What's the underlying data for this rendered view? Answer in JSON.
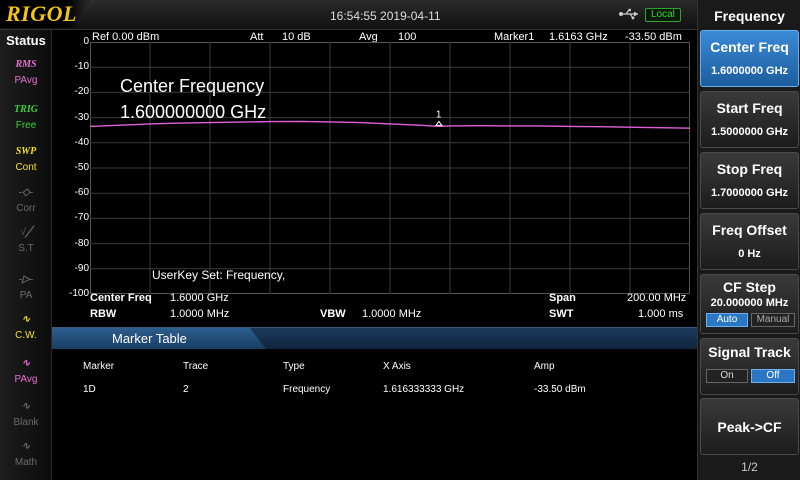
{
  "brand": "RIGOL",
  "clock": "16:54:55 2019-04-11",
  "remote": "Local",
  "status": {
    "title": "Status",
    "items": [
      {
        "icon": "RMS",
        "label": "PAvg",
        "color": "#e86fd0",
        "active": true
      },
      {
        "icon": "TRIG",
        "label": "Free",
        "color": "#3ad23a",
        "active": true
      },
      {
        "icon": "SWP",
        "label": "Cont",
        "color": "#f0e020",
        "active": true
      },
      {
        "icon": "-◇-",
        "label": "Corr",
        "color": "#6a6a6a",
        "active": false
      },
      {
        "icon": "√╱",
        "label": "S.T",
        "color": "#6a6a6a",
        "active": false
      },
      {
        "icon": "-▷-",
        "label": "PA",
        "color": "#6a6a6a",
        "active": false
      },
      {
        "icon": "∿",
        "label": "C.W.",
        "color": "#f0e020",
        "active": true
      },
      {
        "icon": "∿",
        "label": "PAvg",
        "color": "#e86fd0",
        "active": true
      },
      {
        "icon": "∿",
        "label": "Blank",
        "color": "#6a6a6a",
        "active": false
      },
      {
        "icon": "∿",
        "label": "Math",
        "color": "#6a6a6a",
        "active": false
      }
    ]
  },
  "plot_header": {
    "ref": "Ref  0.00 dBm",
    "att_label": "Att",
    "att_value": "10 dB",
    "avg_label": "Avg",
    "avg_value": "100",
    "marker_label": "Marker1",
    "marker_freq": "1.6163 GHz",
    "marker_amp": "-33.50 dBm"
  },
  "overlay": {
    "line1": "Center Frequency",
    "line2": "1.600000000 GHz",
    "userkey": "UserKey Set:    Frequency,",
    "marker_tag": "1"
  },
  "chart_data": {
    "type": "line",
    "ylim": [
      -100,
      0
    ],
    "yticks": [
      "0",
      "-10",
      "-20",
      "-30",
      "-40",
      "-50",
      "-60",
      "-70",
      "-80",
      "-90",
      "-100"
    ],
    "xlim_ghz": [
      1.5,
      1.7
    ],
    "grid": true,
    "series": [
      {
        "color": "#e060d8",
        "x": [
          1.5,
          1.51,
          1.52,
          1.53,
          1.54,
          1.55,
          1.56,
          1.57,
          1.58,
          1.59,
          1.6,
          1.61,
          1.6163,
          1.62,
          1.63,
          1.64,
          1.65,
          1.66,
          1.67,
          1.68,
          1.69,
          1.7
        ],
        "y": [
          -33.5,
          -33.0,
          -32.5,
          -32.2,
          -32.0,
          -31.8,
          -31.6,
          -31.5,
          -31.7,
          -32.0,
          -32.5,
          -33.0,
          -33.5,
          -33.3,
          -33.2,
          -33.3,
          -33.3,
          -33.5,
          -33.6,
          -33.8,
          -34.0,
          -34.2
        ]
      }
    ],
    "marker": {
      "x": 1.6163,
      "y": -33.5
    }
  },
  "info": {
    "center_label": "Center Freq",
    "center_value": "1.6000 GHz",
    "span_label": "Span",
    "span_value": "200.00 MHz",
    "rbw_label": "RBW",
    "rbw_value": "1.0000 MHz",
    "vbw_label": "VBW",
    "vbw_value": "1.0000 MHz",
    "swt_label": "SWT",
    "swt_value": "1.000 ms"
  },
  "marker_table": {
    "title": "Marker Table",
    "headers": [
      "Marker",
      "Trace",
      "Type",
      "X Axis",
      "Amp"
    ],
    "rows": [
      [
        "1D",
        "2",
        "Frequency",
        "1.616333333 GHz",
        "-33.50 dBm"
      ]
    ]
  },
  "panel": {
    "title": "Frequency",
    "keys": [
      {
        "label": "Center Freq",
        "value": "1.6000000 GHz"
      },
      {
        "label": "Start Freq",
        "value": "1.5000000 GHz"
      },
      {
        "label": "Stop Freq",
        "value": "1.7000000 GHz"
      },
      {
        "label": "Freq Offset",
        "value": "0 Hz"
      },
      {
        "label": "CF Step",
        "value": "20.000000 MHz",
        "opt_a": "Auto",
        "opt_b": "Manual"
      },
      {
        "label": "Signal Track",
        "opt_a": "On",
        "opt_b": "Off"
      },
      {
        "label": "Peak->CF"
      }
    ],
    "page": "1/2"
  },
  "colors": {
    "accent": "#2b77c4",
    "trace": "#e060d8",
    "brand": "#f0c418",
    "grid": "#3a3a3a"
  }
}
